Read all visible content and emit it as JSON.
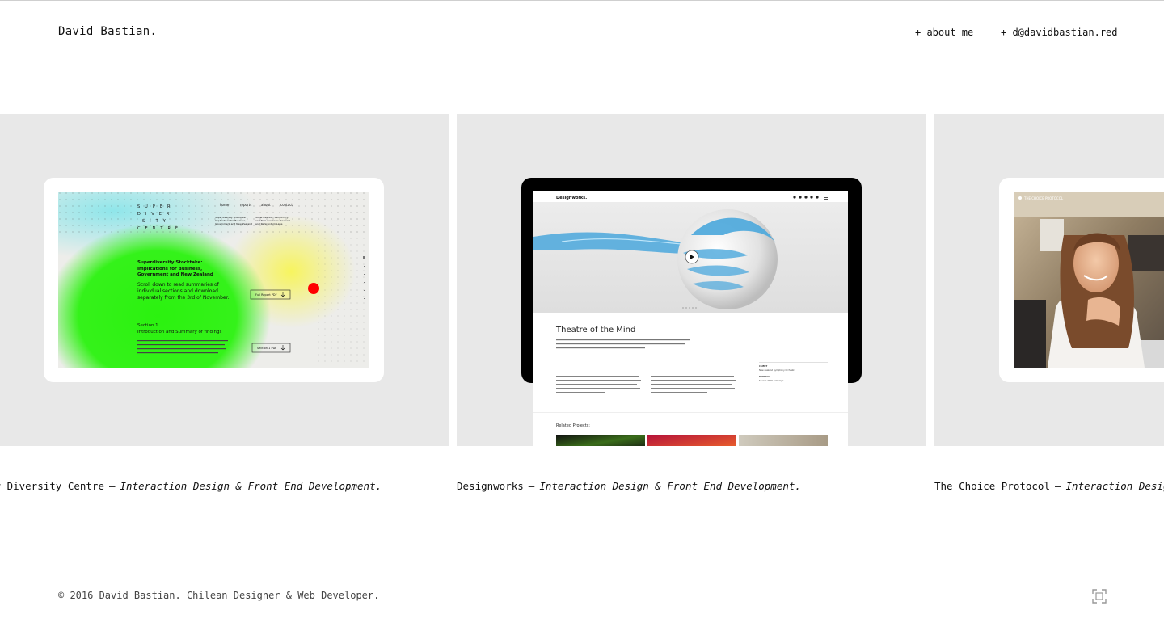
{
  "header": {
    "brand": "David Bastian.",
    "nav": [
      {
        "label": "+ about me"
      },
      {
        "label": "+ d@davidbastian.red"
      }
    ]
  },
  "projects": [
    {
      "title": "er Diversity Centre",
      "role": "Interaction Design & Front End Development.",
      "screen": {
        "logo_lines": [
          "SUPER",
          "DIVER",
          "SITY",
          "CENTRE"
        ],
        "nav": [
          "home",
          "reports",
          "about",
          "contact"
        ],
        "sub1": "Superdiversity Stocktake: Implications for Business, Government and New Zealand",
        "sub2": "Superdiversity, Democracy and New Zealand's Electoral and Referendum Laws",
        "headline": "Superdiversity Stocktake: Implications for Business, Government and New Zealand",
        "intro": "Scroll down to read summaries of individual sections and download separately from the 3rd of November.",
        "section": "Section 1",
        "section_title": "Introduction and Summary of findings",
        "pdf1": "Full Report PDF",
        "pdf2": "Section 1 PDF"
      }
    },
    {
      "title": "Designworks",
      "role": "Interaction Design & Front End Development.",
      "screen": {
        "logo": "Designworks.",
        "headline": "Theatre of the Mind",
        "related": "Related Projects:",
        "client_label": "CLIENT",
        "client": "New Zealand Symphony Orchestra",
        "product_label": "PRODUCT",
        "product": "Season 2016 campaign"
      }
    },
    {
      "title": "The Choice Protocol",
      "role": "Interaction Design & Front End Development.",
      "screen": {
        "logo": "THE CHOICE PROTOCOL"
      }
    }
  ],
  "footer": {
    "copyright": "© 2016 David Bastian. Chilean Designer & Web Developer."
  },
  "colors": {
    "panel_bg": "#e8e8e8",
    "accent_green": "#2bf20f",
    "accent_yellow": "#f5f27a",
    "accent_cyan": "#8fe6ea",
    "dot_red": "#ff0000",
    "splash_blue": "#4aa7dc"
  },
  "icons": {
    "fullscreen": "fullscreen-icon",
    "play": "play-icon"
  }
}
